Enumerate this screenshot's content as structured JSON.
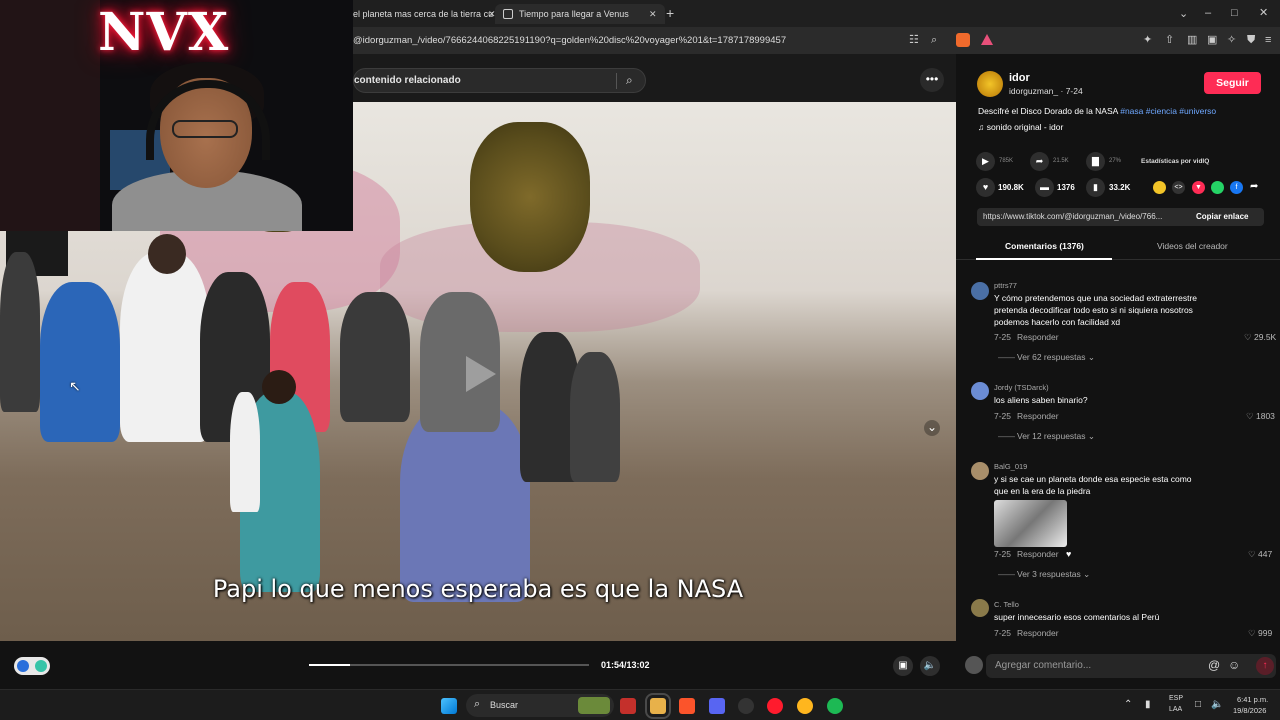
{
  "browser": {
    "tabs": [
      {
        "label": "el planeta mas cerca de la tierra cuan"
      },
      {
        "label": "Tiempo para llegar a Venus"
      }
    ],
    "url": "@idorguzman_/video/7666244068225191190?q=golden%20disc%20voyager%201&t=1787178999457"
  },
  "video": {
    "search_placeholder": "contenido relacionado",
    "subtitle": "Papi lo que menos esperaba es que la NASA",
    "current_time": "01:54",
    "duration": "13:02",
    "time_display": "01:54/13:02",
    "progress_fraction": 0.146
  },
  "webcam": {
    "neon_sign": "NVX"
  },
  "post": {
    "author_name": "idor",
    "author_handle": "idorguzman_ · 7-24",
    "follow_label": "Seguir",
    "description": "Descifré el Disco Dorado de la NASA",
    "hashtags": "#nasa #ciencia #universo",
    "music": "sonido original - idor",
    "plays": "785K",
    "shares_small": "21.5K",
    "stat_pct": "27%",
    "stats_label": "Estadísticas por vidIQ",
    "likes": "190.8K",
    "comments": "1376",
    "saves": "33.2K",
    "link": "https://www.tiktok.com/@idorguzman_/video/766...",
    "copy_link_label": "Copiar enlace"
  },
  "tabs": {
    "comments": "Comentarios (1376)",
    "creator_videos": "Videos del creador"
  },
  "comments": [
    {
      "user": "pttrs77",
      "text": [
        "Y cómo pretendemos que una sociedad extraterrestre",
        "pretenda decodificar todo esto si ni siquiera nosotros",
        "podemos hacerlo con facilidad xd"
      ],
      "date": "7-25",
      "reply": "Responder",
      "likes": "29.5K",
      "replies": "Ver 62 respuestas"
    },
    {
      "user": "Jordy (TSDarck)",
      "text": [
        "los aliens saben binario?"
      ],
      "date": "7-25",
      "reply": "Responder",
      "likes": "1803",
      "replies": "Ver 12 respuestas"
    },
    {
      "user": "BalG_019",
      "text": [
        "y si se cae un planeta donde esa especie esta como",
        "que en la era de la piedra"
      ],
      "date": "7-25",
      "reply": "Responder",
      "likes": "447",
      "replies": "Ver 3 respuestas"
    },
    {
      "user": "C. Tello",
      "text": [
        "super innecesario esos comentarios al Perú"
      ],
      "date": "7-25",
      "reply": "Responder",
      "likes": "999"
    }
  ],
  "comment_input_placeholder": "Agregar comentario...",
  "taskbar": {
    "search_label": "Buscar",
    "lang_top": "ESP",
    "lang_bottom": "LAA",
    "time": "6:41 p.m.",
    "date": "19/8/2026"
  },
  "icons": {
    "play": "play-icon",
    "share": "share-icon",
    "heart": "heart-icon",
    "comment": "comment-icon",
    "bookmark": "bookmark-icon"
  },
  "colors": {
    "accent": "#fe2c55",
    "hashtag": "#6fa8ff"
  }
}
